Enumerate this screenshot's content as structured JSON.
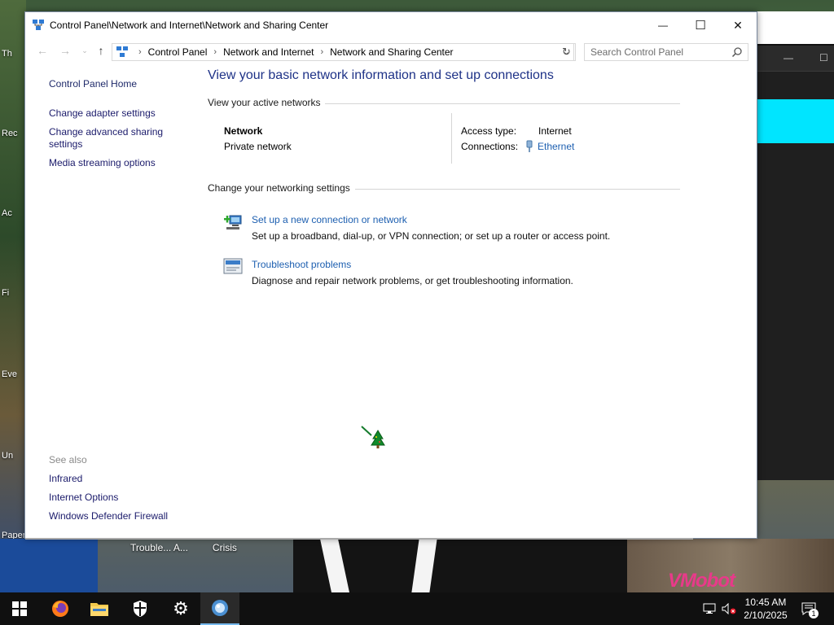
{
  "window": {
    "title": "Control Panel\\Network and Internet\\Network and Sharing Center",
    "controls": {
      "minimize": "—",
      "maximize": "☐",
      "close": "✕"
    }
  },
  "address": {
    "crumbs": [
      "Control Panel",
      "Network and Internet",
      "Network and Sharing Center"
    ],
    "search_placeholder": "Search Control Panel"
  },
  "left_pane": {
    "home": "Control Panel Home",
    "links": [
      "Change adapter settings",
      "Change advanced sharing settings",
      "Media streaming options"
    ],
    "see_also_title": "See also",
    "see_also": [
      "Infrared",
      "Internet Options",
      "Windows Defender Firewall"
    ]
  },
  "main": {
    "heading": "View your basic network information and set up connections",
    "active_networks_title": "View your active networks",
    "network": {
      "name": "Network",
      "category": "Private network",
      "access_type_label": "Access type:",
      "access_type_value": "Internet",
      "connections_label": "Connections:",
      "connections_value": "Ethernet"
    },
    "change_settings_title": "Change your networking settings",
    "tasks": [
      {
        "link": "Set up a new connection or network",
        "desc": "Set up a broadband, dial-up, or VPN connection; or set up a router or access point."
      },
      {
        "link": "Troubleshoot problems",
        "desc": "Diagnose and repair network problems, or get troubleshooting information."
      }
    ]
  },
  "desktop": {
    "icon_labels": [
      "Th",
      "Rec",
      "Ac",
      "Fi",
      "Eve",
      "Un",
      "Papers"
    ],
    "bottom_labels": [
      "Trouble... A...",
      "Crisis"
    ],
    "watermark": "VMobot"
  },
  "taskbar": {
    "time": "10:45 AM",
    "date": "2/10/2025",
    "notification_count": "1"
  },
  "colors": {
    "link": "#1d5fb0",
    "heading": "#1e3287",
    "accent": "#76b9ed"
  }
}
